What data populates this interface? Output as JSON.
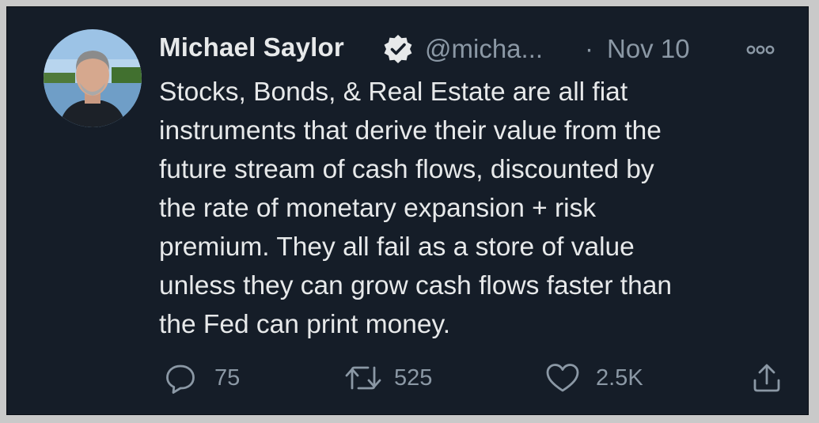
{
  "tweet": {
    "author": {
      "name": "Michael Saylor",
      "handle": "@micha...",
      "verified_icon": "verified-badge-icon",
      "avatar_icon": "profile-photo"
    },
    "separator": "·",
    "date": "Nov 10",
    "text": "Stocks, Bonds, & Real Estate are all fiat\ninstruments that derive their value from the\nfuture stream of cash flows, discounted by\nthe rate of monetary expansion + risk\npremium.  They all fail as a store of value\nunless they can grow cash flows faster than\nthe Fed can print money.",
    "actions": {
      "reply": {
        "icon": "reply-icon",
        "count": "75"
      },
      "retweet": {
        "icon": "retweet-icon",
        "count": "525"
      },
      "like": {
        "icon": "heart-icon",
        "count": "2.5K"
      },
      "share": {
        "icon": "share-icon"
      }
    },
    "more_icon": "more-options-icon"
  },
  "colors": {
    "background": "#151d28",
    "text_primary": "#e7e9ea",
    "text_secondary": "#8b98a5",
    "frame": "#c9c9c9"
  }
}
